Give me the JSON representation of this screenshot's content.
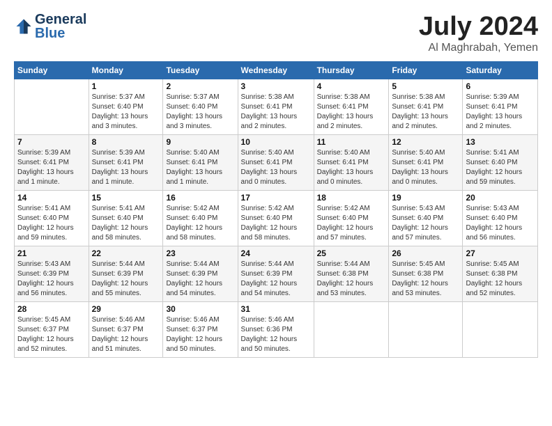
{
  "logo": {
    "name": "General",
    "name2": "Blue"
  },
  "header": {
    "month": "July 2024",
    "location": "Al Maghrabah, Yemen"
  },
  "weekdays": [
    "Sunday",
    "Monday",
    "Tuesday",
    "Wednesday",
    "Thursday",
    "Friday",
    "Saturday"
  ],
  "weeks": [
    [
      {
        "day": "",
        "info": ""
      },
      {
        "day": "1",
        "info": "Sunrise: 5:37 AM\nSunset: 6:40 PM\nDaylight: 13 hours\nand 3 minutes."
      },
      {
        "day": "2",
        "info": "Sunrise: 5:37 AM\nSunset: 6:40 PM\nDaylight: 13 hours\nand 3 minutes."
      },
      {
        "day": "3",
        "info": "Sunrise: 5:38 AM\nSunset: 6:41 PM\nDaylight: 13 hours\nand 2 minutes."
      },
      {
        "day": "4",
        "info": "Sunrise: 5:38 AM\nSunset: 6:41 PM\nDaylight: 13 hours\nand 2 minutes."
      },
      {
        "day": "5",
        "info": "Sunrise: 5:38 AM\nSunset: 6:41 PM\nDaylight: 13 hours\nand 2 minutes."
      },
      {
        "day": "6",
        "info": "Sunrise: 5:39 AM\nSunset: 6:41 PM\nDaylight: 13 hours\nand 2 minutes."
      }
    ],
    [
      {
        "day": "7",
        "info": "Sunrise: 5:39 AM\nSunset: 6:41 PM\nDaylight: 13 hours\nand 1 minute."
      },
      {
        "day": "8",
        "info": "Sunrise: 5:39 AM\nSunset: 6:41 PM\nDaylight: 13 hours\nand 1 minute."
      },
      {
        "day": "9",
        "info": "Sunrise: 5:40 AM\nSunset: 6:41 PM\nDaylight: 13 hours\nand 1 minute."
      },
      {
        "day": "10",
        "info": "Sunrise: 5:40 AM\nSunset: 6:41 PM\nDaylight: 13 hours\nand 0 minutes."
      },
      {
        "day": "11",
        "info": "Sunrise: 5:40 AM\nSunset: 6:41 PM\nDaylight: 13 hours\nand 0 minutes."
      },
      {
        "day": "12",
        "info": "Sunrise: 5:40 AM\nSunset: 6:41 PM\nDaylight: 13 hours\nand 0 minutes."
      },
      {
        "day": "13",
        "info": "Sunrise: 5:41 AM\nSunset: 6:40 PM\nDaylight: 12 hours\nand 59 minutes."
      }
    ],
    [
      {
        "day": "14",
        "info": "Sunrise: 5:41 AM\nSunset: 6:40 PM\nDaylight: 12 hours\nand 59 minutes."
      },
      {
        "day": "15",
        "info": "Sunrise: 5:41 AM\nSunset: 6:40 PM\nDaylight: 12 hours\nand 58 minutes."
      },
      {
        "day": "16",
        "info": "Sunrise: 5:42 AM\nSunset: 6:40 PM\nDaylight: 12 hours\nand 58 minutes."
      },
      {
        "day": "17",
        "info": "Sunrise: 5:42 AM\nSunset: 6:40 PM\nDaylight: 12 hours\nand 58 minutes."
      },
      {
        "day": "18",
        "info": "Sunrise: 5:42 AM\nSunset: 6:40 PM\nDaylight: 12 hours\nand 57 minutes."
      },
      {
        "day": "19",
        "info": "Sunrise: 5:43 AM\nSunset: 6:40 PM\nDaylight: 12 hours\nand 57 minutes."
      },
      {
        "day": "20",
        "info": "Sunrise: 5:43 AM\nSunset: 6:40 PM\nDaylight: 12 hours\nand 56 minutes."
      }
    ],
    [
      {
        "day": "21",
        "info": "Sunrise: 5:43 AM\nSunset: 6:39 PM\nDaylight: 12 hours\nand 56 minutes."
      },
      {
        "day": "22",
        "info": "Sunrise: 5:44 AM\nSunset: 6:39 PM\nDaylight: 12 hours\nand 55 minutes."
      },
      {
        "day": "23",
        "info": "Sunrise: 5:44 AM\nSunset: 6:39 PM\nDaylight: 12 hours\nand 54 minutes."
      },
      {
        "day": "24",
        "info": "Sunrise: 5:44 AM\nSunset: 6:39 PM\nDaylight: 12 hours\nand 54 minutes."
      },
      {
        "day": "25",
        "info": "Sunrise: 5:44 AM\nSunset: 6:38 PM\nDaylight: 12 hours\nand 53 minutes."
      },
      {
        "day": "26",
        "info": "Sunrise: 5:45 AM\nSunset: 6:38 PM\nDaylight: 12 hours\nand 53 minutes."
      },
      {
        "day": "27",
        "info": "Sunrise: 5:45 AM\nSunset: 6:38 PM\nDaylight: 12 hours\nand 52 minutes."
      }
    ],
    [
      {
        "day": "28",
        "info": "Sunrise: 5:45 AM\nSunset: 6:37 PM\nDaylight: 12 hours\nand 52 minutes."
      },
      {
        "day": "29",
        "info": "Sunrise: 5:46 AM\nSunset: 6:37 PM\nDaylight: 12 hours\nand 51 minutes."
      },
      {
        "day": "30",
        "info": "Sunrise: 5:46 AM\nSunset: 6:37 PM\nDaylight: 12 hours\nand 50 minutes."
      },
      {
        "day": "31",
        "info": "Sunrise: 5:46 AM\nSunset: 6:36 PM\nDaylight: 12 hours\nand 50 minutes."
      },
      {
        "day": "",
        "info": ""
      },
      {
        "day": "",
        "info": ""
      },
      {
        "day": "",
        "info": ""
      }
    ]
  ]
}
